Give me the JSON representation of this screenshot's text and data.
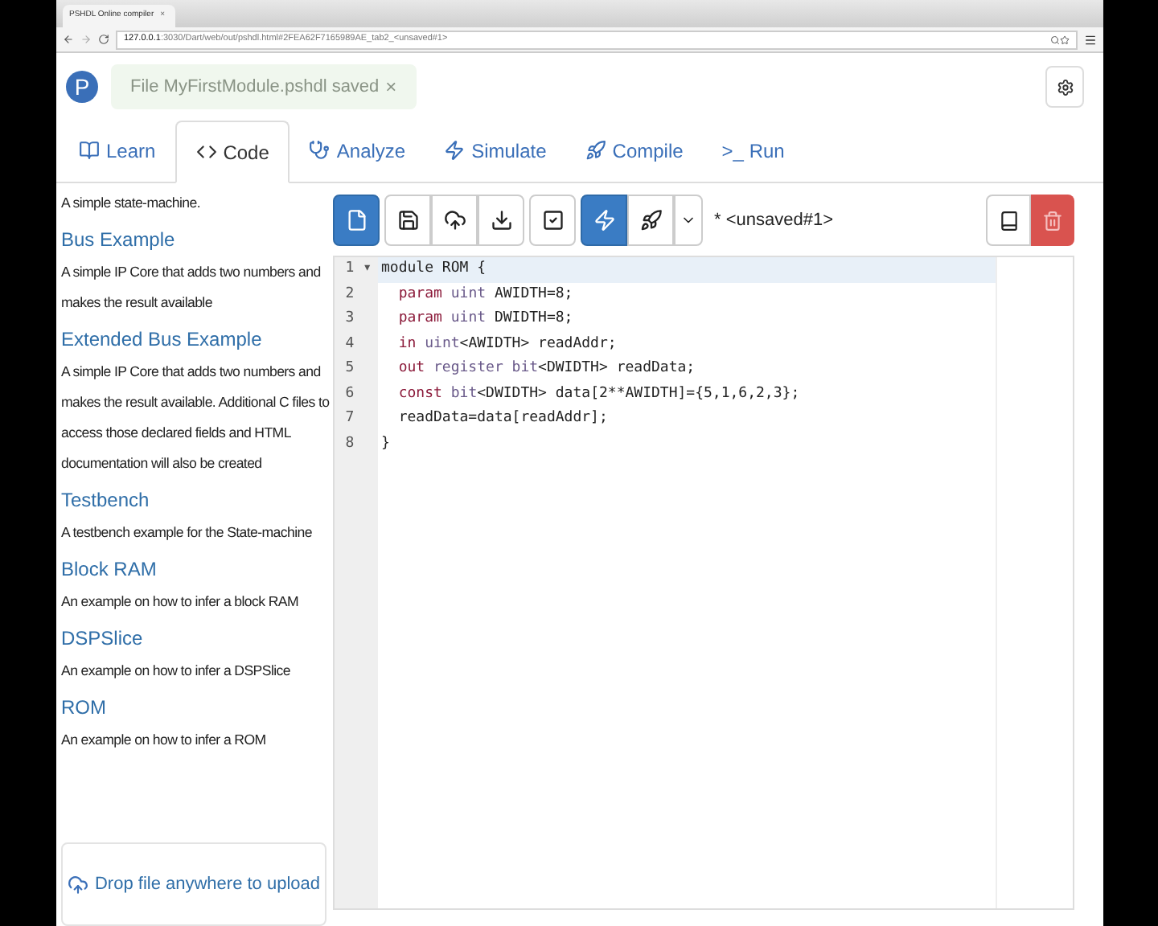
{
  "browser": {
    "tab_title": "PSHDL Online compiler",
    "tab_close": "×",
    "url_host": "127.0.0.1",
    "url_rest": ":3030/Dart/web/out/pshdl.html#2FEA62F7165989AE_tab2_<unsaved#1>"
  },
  "logo": "P",
  "toast": {
    "text": "File MyFirstModule.pshdl saved",
    "close": "×"
  },
  "tabs": [
    {
      "label": "Learn",
      "kind": "book",
      "selected": false
    },
    {
      "label": "Code",
      "kind": "code",
      "selected": true
    },
    {
      "label": "Analyze",
      "kind": "stethoscope",
      "selected": false
    },
    {
      "label": "Simulate",
      "kind": "bolt",
      "selected": false
    },
    {
      "label": "Compile",
      "kind": "rocket",
      "selected": false
    },
    {
      "label": ">_ Run",
      "kind": "text",
      "selected": false
    }
  ],
  "examples": [
    {
      "description": "A simple state-machine."
    },
    {
      "title": "Bus Example",
      "description": "A simple IP Core that adds two numbers and makes the result available"
    },
    {
      "title": "Extended Bus Example",
      "description": "A simple IP Core that adds two numbers and makes the result available. Additional C files to access those declared fields and HTML documentation will also be created"
    },
    {
      "title": "Testbench",
      "description": "A testbench example for the State-machine"
    },
    {
      "title": "Block RAM",
      "description": "An example on how to infer a block RAM"
    },
    {
      "title": "DSPSlice",
      "description": "An example on how to infer a DSPSlice"
    },
    {
      "title": "ROM",
      "description": "An example on how to infer a ROM"
    }
  ],
  "upload": {
    "text": "Drop file anywhere to upload"
  },
  "toolbar": [
    {
      "group": [
        {
          "kind": "file",
          "selected": true
        }
      ]
    },
    {
      "group": [
        {
          "kind": "save",
          "selected": false
        },
        {
          "kind": "upload",
          "selected": false
        },
        {
          "kind": "download",
          "selected": false
        }
      ]
    },
    {
      "group": [
        {
          "kind": "check",
          "selected": false
        }
      ]
    },
    {
      "group": [
        {
          "kind": "bolt",
          "selected": true
        },
        {
          "kind": "rocket",
          "selected": false
        },
        {
          "kind": "caret",
          "selected": false
        }
      ]
    }
  ],
  "file_name": "* <unsaved#1>",
  "editor": {
    "lines": [
      {
        "number": "1",
        "fold": "▾",
        "tokens": [
          {
            "text": "module ROM {",
            "kind": "plain"
          }
        ]
      },
      {
        "number": "2",
        "tokens": [
          {
            "text": "  param",
            "kind": "keyword"
          },
          {
            "text": " uint",
            "kind": "type"
          },
          {
            "text": " AWIDTH=8;",
            "kind": "plain"
          }
        ]
      },
      {
        "number": "3",
        "tokens": [
          {
            "text": "  param",
            "kind": "keyword"
          },
          {
            "text": " uint",
            "kind": "type"
          },
          {
            "text": " DWIDTH=8;",
            "kind": "plain"
          }
        ]
      },
      {
        "number": "4",
        "tokens": [
          {
            "text": "  in",
            "kind": "keyword"
          },
          {
            "text": " uint",
            "kind": "type"
          },
          {
            "text": "<AWIDTH> readAddr;",
            "kind": "plain"
          }
        ]
      },
      {
        "number": "5",
        "tokens": [
          {
            "text": "  out",
            "kind": "keyword"
          },
          {
            "text": " register bit",
            "kind": "type"
          },
          {
            "text": "<DWIDTH> readData;",
            "kind": "plain"
          }
        ]
      },
      {
        "number": "6",
        "tokens": [
          {
            "text": "  const",
            "kind": "keyword"
          },
          {
            "text": " bit",
            "kind": "type"
          },
          {
            "text": "<DWIDTH> data[2**AWIDTH]={5,1,6,2,3};",
            "kind": "plain"
          }
        ]
      },
      {
        "number": "7",
        "tokens": [
          {
            "text": "  readData=data[readAddr];",
            "kind": "plain"
          }
        ]
      },
      {
        "number": "8",
        "tokens": [
          {
            "text": "}",
            "kind": "plain"
          }
        ]
      }
    ]
  }
}
